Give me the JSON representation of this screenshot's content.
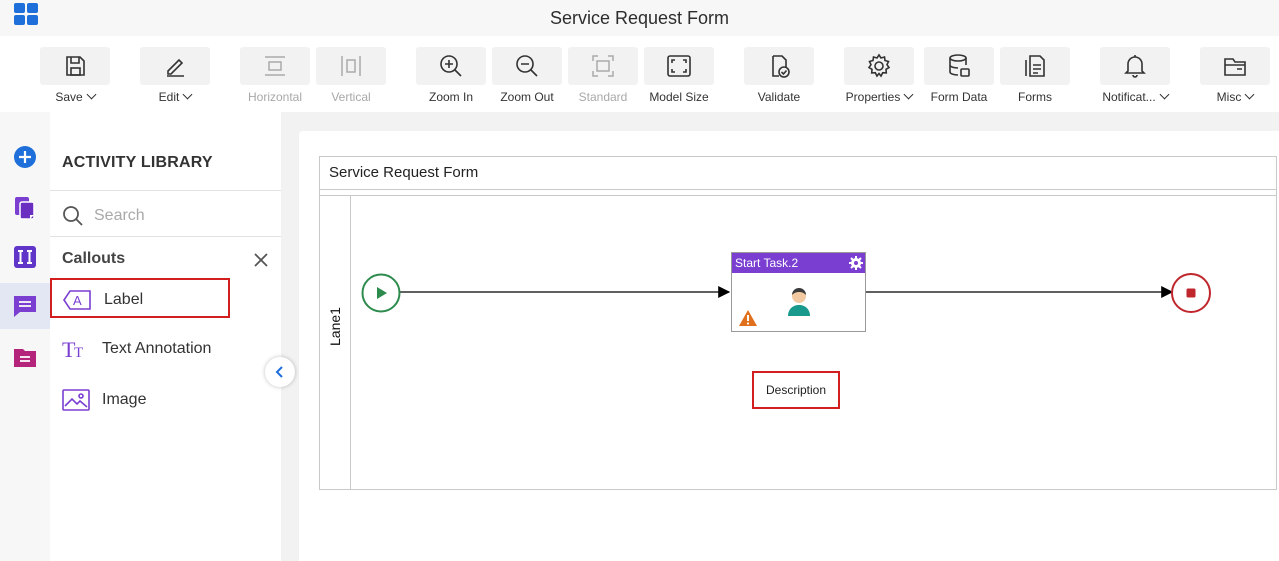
{
  "header": {
    "title": "Service Request Form",
    "app_icon": "app-grid-icon"
  },
  "toolbar": {
    "items": [
      {
        "label": "Save",
        "icon": "save-icon",
        "dropdown": true,
        "enabled": true
      },
      {
        "label": "Edit",
        "icon": "pencil-icon",
        "dropdown": true,
        "enabled": true
      },
      {
        "label": "Horizontal",
        "icon": "horizontal-layout-icon",
        "dropdown": false,
        "enabled": false
      },
      {
        "label": "Vertical",
        "icon": "vertical-layout-icon",
        "dropdown": false,
        "enabled": false
      },
      {
        "label": "Zoom In",
        "icon": "zoom-in-icon",
        "dropdown": false,
        "enabled": true
      },
      {
        "label": "Zoom Out",
        "icon": "zoom-out-icon",
        "dropdown": false,
        "enabled": true
      },
      {
        "label": "Standard",
        "icon": "standard-size-icon",
        "dropdown": false,
        "enabled": false
      },
      {
        "label": "Model Size",
        "icon": "model-size-icon",
        "dropdown": false,
        "enabled": true
      },
      {
        "label": "Validate",
        "icon": "validate-icon",
        "dropdown": false,
        "enabled": true
      },
      {
        "label": "Properties",
        "icon": "gear-icon",
        "dropdown": true,
        "enabled": true
      },
      {
        "label": "Form Data",
        "icon": "database-icon",
        "dropdown": false,
        "enabled": true
      },
      {
        "label": "Forms",
        "icon": "forms-icon",
        "dropdown": false,
        "enabled": true
      },
      {
        "label": "Notificat...",
        "icon": "bell-icon",
        "dropdown": true,
        "enabled": true
      },
      {
        "label": "Misc",
        "icon": "folder-icon",
        "dropdown": true,
        "enabled": true
      }
    ]
  },
  "rail": {
    "items": [
      {
        "icon": "add-circle-icon",
        "color": "#1e6fd9"
      },
      {
        "icon": "pages-icon",
        "color": "#7a3fd1"
      },
      {
        "icon": "columns-icon",
        "color": "#5f36c8"
      },
      {
        "icon": "callout-chat-icon",
        "color": "#7a3fd1",
        "active": true
      },
      {
        "icon": "form-file-icon",
        "color": "#b3247a"
      }
    ]
  },
  "library": {
    "title": "ACTIVITY LIBRARY",
    "search": {
      "placeholder": "Search",
      "value": ""
    },
    "category": "Callouts",
    "items": [
      {
        "label": "Label",
        "icon": "label-a-icon",
        "selected": true
      },
      {
        "label": "Text Annotation",
        "icon": "text-annotation-icon",
        "selected": false
      },
      {
        "label": "Image",
        "icon": "image-icon",
        "selected": false
      }
    ]
  },
  "canvas": {
    "pool_title": "Service Request Form",
    "lane_label": "Lane1",
    "task": {
      "name": "Start Task.2",
      "header_color": "#7a3fd1"
    },
    "description_label": "Description",
    "start_event_color": "#2e8b4e",
    "end_event_color": "#c0272d"
  }
}
